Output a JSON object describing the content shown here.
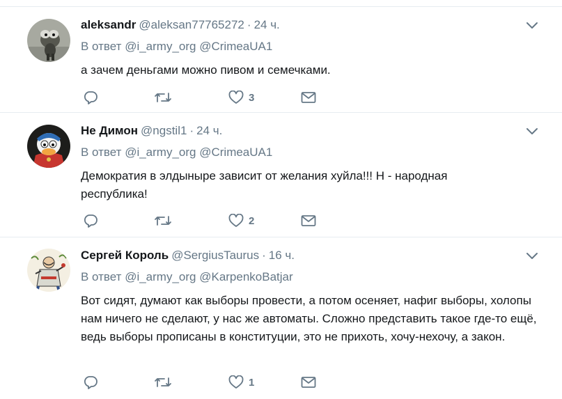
{
  "colors": {
    "text": "#14171a",
    "secondary": "#657786",
    "border": "#e6ecf0",
    "icon": "#657786"
  },
  "reply_prefix": "В ответ",
  "tweets": [
    {
      "fullname": "aleksandr",
      "username": "@aleksan77765272",
      "dot": "·",
      "time": "24 ч.",
      "reply_to": [
        "@i_army_org",
        "@CrimeaUA1"
      ],
      "text": "а зачем деньгами можно пивом и семечками.",
      "reply_count": "",
      "retweet_count": "",
      "like_count": "3",
      "avatar": "raccoon-photo"
    },
    {
      "fullname": "Не Димон",
      "username": "@ngstil1",
      "dot": "·",
      "time": "24 ч.",
      "reply_to": [
        "@i_army_org",
        "@CrimeaUA1"
      ],
      "text": "Демократия в элдыныре зависит от желания хуйла!!! Н - народная республика!",
      "reply_count": "",
      "retweet_count": "",
      "like_count": "2",
      "avatar": "cartoon-duck"
    },
    {
      "fullname": "Сергей Король",
      "username": "@SergiusTaurus",
      "dot": "·",
      "time": "16 ч.",
      "reply_to": [
        "@i_army_org",
        "@KarpenkoBatjar"
      ],
      "text": "Вот сидят, думают как выборы провести, а потом осеняет, нафиг выборы, холопы нам ничего не сделают, у нас же автоматы.  Сложно представить такое где-то ещё, ведь выборы прописаны в конституции, это не прихоть, хочу-нехочу, а закон.",
      "reply_count": "",
      "retweet_count": "",
      "like_count": "1",
      "avatar": "cossack-illustration"
    }
  ]
}
